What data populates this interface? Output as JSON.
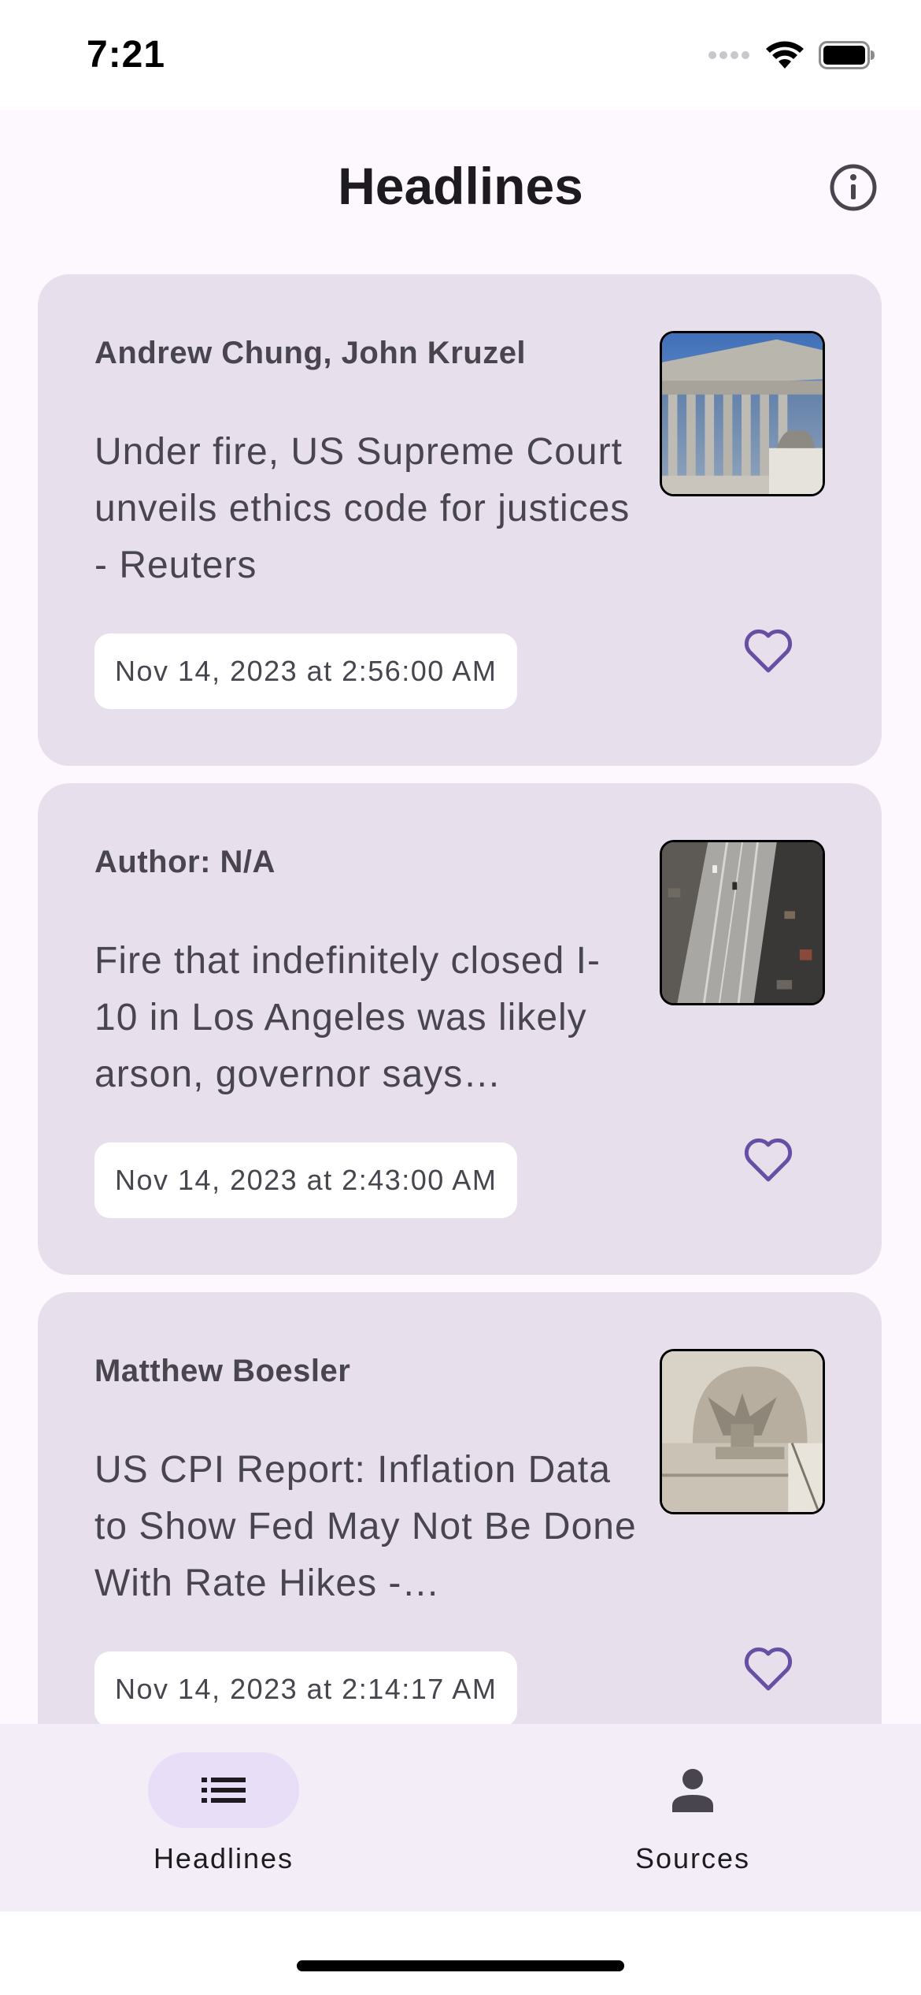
{
  "status_bar": {
    "time": "7:21",
    "icons": [
      "signal-dots-icon",
      "wifi-icon",
      "battery-icon"
    ]
  },
  "app_bar": {
    "title": "Headlines",
    "info_icon": "info-icon"
  },
  "articles": [
    {
      "author": "Andrew Chung, John Kruzel",
      "title": "Under fire, US Supreme Court unveils ethics code for justices - Reuters",
      "date": "Nov 14, 2023 at 2:56:00 AM",
      "thumbnail": "supreme-court-building-image",
      "favorite_icon": "heart-outline-icon"
    },
    {
      "author": "Author: N/A",
      "title": "Fire that indefinitely closed I-10 in Los Angeles was likely arson, governor says…",
      "date": "Nov 14, 2023 at 2:43:00 AM",
      "thumbnail": "freeway-aerial-image",
      "favorite_icon": "heart-outline-icon"
    },
    {
      "author": "Matthew Boesler",
      "title": "US CPI Report: Inflation Data to Show Fed May Not Be Done With Rate Hikes -…",
      "date": "Nov 14, 2023 at 2:14:17 AM",
      "thumbnail": "federal-reserve-eagle-image",
      "favorite_icon": "heart-outline-icon"
    }
  ],
  "bottom_nav": {
    "items": [
      {
        "label": "Headlines",
        "icon": "list-icon",
        "active": true
      },
      {
        "label": "Sources",
        "icon": "person-icon",
        "active": false
      }
    ]
  },
  "colors": {
    "accent": "#6750a4",
    "card_bg": "#e7e0ec",
    "nav_bg": "#f3edf7",
    "active_pill": "#e8def8"
  }
}
